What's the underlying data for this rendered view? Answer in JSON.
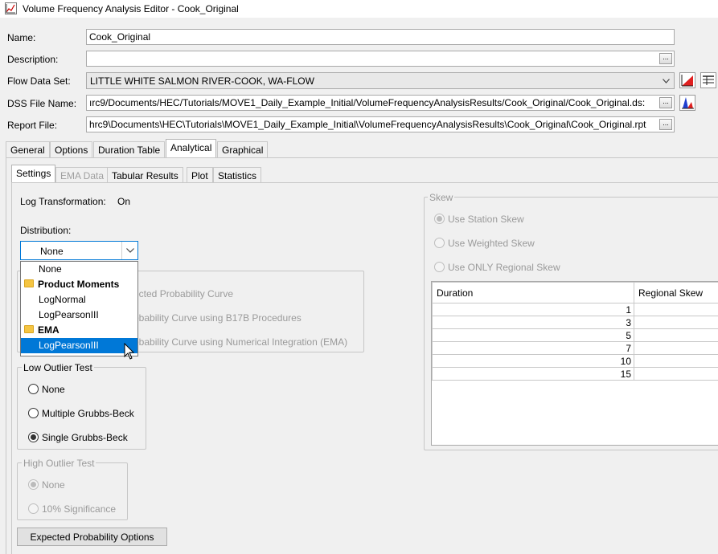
{
  "window": {
    "title": "Volume Frequency Analysis Editor - Cook_Original"
  },
  "form": {
    "name_label": "Name:",
    "name_value": "Cook_Original",
    "description_label": "Description:",
    "description_value": "",
    "flow_label": "Flow Data Set:",
    "flow_value": "LITTLE WHITE SALMON RIVER-COOK, WA-FLOW",
    "dss_label": "DSS File Name:",
    "dss_value": "ırc9/Documents/HEC/Tutorials/MOVE1_Daily_Example_Initial/VolumeFrequencyAnalysisResults/Cook_Original/Cook_Original.ds:",
    "report_label": "Report File:",
    "report_value": "hrc9\\Documents\\HEC\\Tutorials\\MOVE1_Daily_Example_Initial\\VolumeFrequencyAnalysisResults\\Cook_Original\\Cook_Original.rpt",
    "browse_label": "..."
  },
  "main_tabs": [
    "General",
    "Options",
    "Duration Table",
    "Analytical",
    "Graphical"
  ],
  "sub_tabs": [
    "Settings",
    "EMA Data",
    "Tabular Results",
    "Plot",
    "Statistics"
  ],
  "settings": {
    "log_label": "Log Transformation:",
    "log_value": "On",
    "distribution_label": "Distribution:",
    "distribution_value": "None",
    "dropdown": {
      "none": "None",
      "group1": "Product Moments",
      "lognormal": "LogNormal",
      "logpearson1": "LogPearsonIII",
      "group2": "EMA",
      "logpearson2": "LogPearsonIII"
    },
    "curve_options": [
      "ected Probability Curve",
      "obability Curve using B17B Procedures",
      "obability Curve using Numerical Integration (EMA)"
    ],
    "low_outlier": {
      "title": "Low Outlier Test",
      "options": [
        "None",
        "Multiple Grubbs-Beck",
        "Single Grubbs-Beck"
      ],
      "selected": 2
    },
    "high_outlier": {
      "title": "High Outlier Test",
      "options": [
        "None",
        "10% Significance"
      ],
      "selected": 0
    },
    "expected_button": "Expected Probability Options"
  },
  "skew": {
    "title": "Skew",
    "options": [
      "Use Station Skew",
      "Use Weighted Skew",
      "Use ONLY Regional Skew"
    ],
    "selected": 0,
    "columns": [
      "Duration",
      "Regional Skew"
    ],
    "rows": [
      {
        "duration": "1",
        "regional_skew": ""
      },
      {
        "duration": "3",
        "regional_skew": ""
      },
      {
        "duration": "5",
        "regional_skew": ""
      },
      {
        "duration": "7",
        "regional_skew": ""
      },
      {
        "duration": "10",
        "regional_skew": ""
      },
      {
        "duration": "15",
        "regional_skew": ""
      }
    ]
  },
  "icons": {
    "app": "chart-icon",
    "plot_button": "red-curve-chart-icon",
    "table_button": "table-icon",
    "dss_button": "blue-red-chart-icon",
    "dropdown_arrow": "chevron-down-icon",
    "folder": "folder-icon",
    "cursor": "mouse-pointer-icon"
  },
  "colors": {
    "selection": "#0078d7",
    "folder": "#f5c542"
  }
}
